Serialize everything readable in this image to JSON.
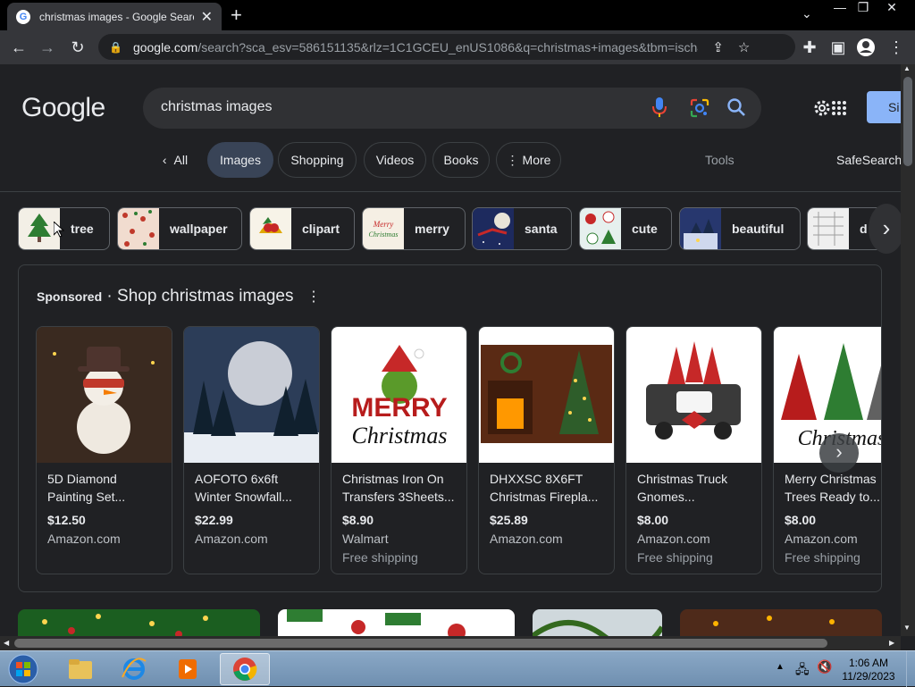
{
  "browser": {
    "tab_title": "christmas images - Google Search",
    "url_host": "google.com",
    "url_rest": "/search?sca_esv=586151135&rlz=1C1GCEU_enUS1086&q=christmas+images&tbm=isch&sour..."
  },
  "google": {
    "logo": "Google",
    "query": "christmas images",
    "signin_label": "Si",
    "filters": [
      "All",
      "Images",
      "Shopping",
      "Videos",
      "Books",
      "More"
    ],
    "active_filter": "Images",
    "tools_label": "Tools",
    "safesearch_label": "SafeSearch"
  },
  "related": [
    {
      "label": "tree",
      "color": "#f3efe6"
    },
    {
      "label": "wallpaper",
      "color": "#e9c9b8"
    },
    {
      "label": "clipart",
      "color": "#f7f3e8"
    },
    {
      "label": "merry",
      "color": "#f5efe4"
    },
    {
      "label": "santa",
      "color": "#1d2a5e"
    },
    {
      "label": "cute",
      "color": "#e6f0ee"
    },
    {
      "label": "beautiful",
      "color": "#27376e"
    },
    {
      "label": "d",
      "color": "#efefef"
    }
  ],
  "shopping": {
    "sponsored": "Sponsored",
    "separator": " · ",
    "title": "Shop christmas images",
    "products": [
      {
        "title": "5D Diamond Painting Set...",
        "price": "$12.50",
        "store": "Amazon.com",
        "shipping": "",
        "color": "#3a2a20"
      },
      {
        "title": "AOFOTO 6x6ft Winter Snowfall...",
        "price": "$22.99",
        "store": "Amazon.com",
        "shipping": "",
        "color": "#2c3d58"
      },
      {
        "title": "Christmas Iron On Transfers 3Sheets...",
        "price": "$8.90",
        "store": "Walmart",
        "shipping": "Free shipping",
        "color": "#ffffff"
      },
      {
        "title": "DHXXSC 8X6FT Christmas Firepla...",
        "price": "$25.89",
        "store": "Amazon.com",
        "shipping": "",
        "color": "#5a2a14"
      },
      {
        "title": "Christmas Truck Gnomes...",
        "price": "$8.00",
        "store": "Amazon.com",
        "shipping": "Free shipping",
        "color": "#ffffff"
      },
      {
        "title": "Merry Christmas Trees Ready to...",
        "price": "$8.00",
        "store": "Amazon.com",
        "shipping": "Free shipping",
        "color": "#ffffff"
      }
    ]
  },
  "taskbar": {
    "time": "1:06 AM",
    "date": "11/29/2023"
  },
  "colors": {
    "page_bg": "#202124",
    "accent": "#8ab4f8",
    "active_chip": "#394457"
  }
}
